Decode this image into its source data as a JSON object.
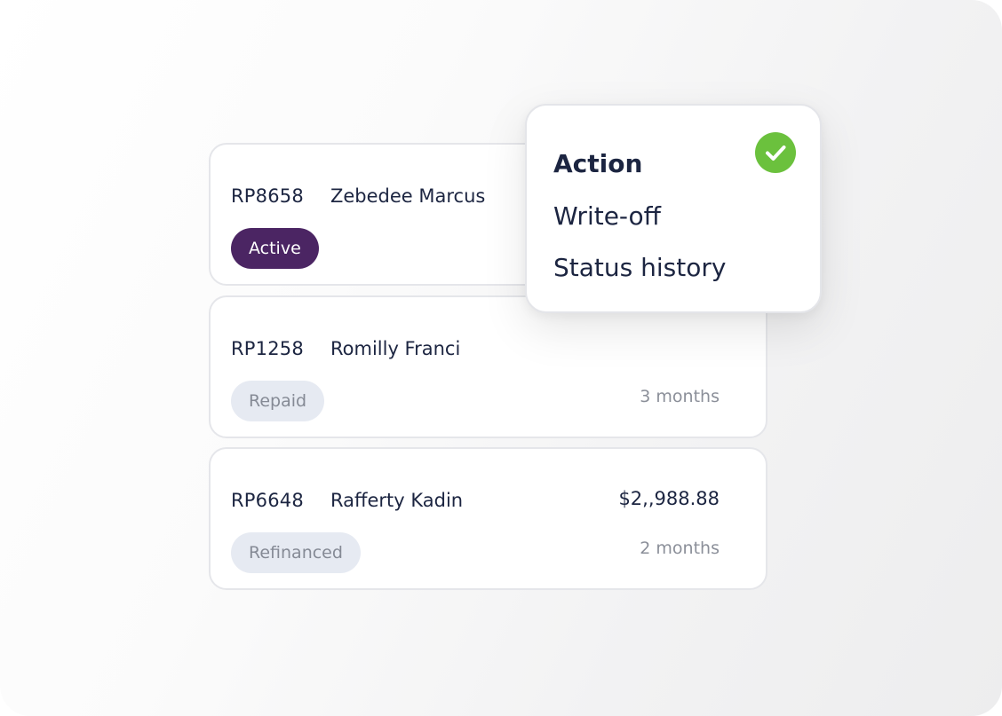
{
  "loans": [
    {
      "id": "RP8658",
      "name": "Zebedee Marcus",
      "status": "Active",
      "amount": "",
      "term": ""
    },
    {
      "id": "RP1258",
      "name": "Romilly Franci",
      "status": "Repaid",
      "amount": "",
      "term": "3 months"
    },
    {
      "id": "RP6648",
      "name": "Rafferty Kadin",
      "status": "Refinanced",
      "amount": "$2,,988.88",
      "term": "2 months"
    }
  ],
  "menu": {
    "items": [
      {
        "label": "Action",
        "selected": true
      },
      {
        "label": "Write-off",
        "selected": false
      },
      {
        "label": "Status history",
        "selected": false
      }
    ],
    "selected_icon": "check-circle-icon"
  },
  "colors": {
    "active_badge": "#4b2563",
    "muted_badge": "#e6eaf2",
    "check": "#6bc13d",
    "text": "#1c2541"
  }
}
